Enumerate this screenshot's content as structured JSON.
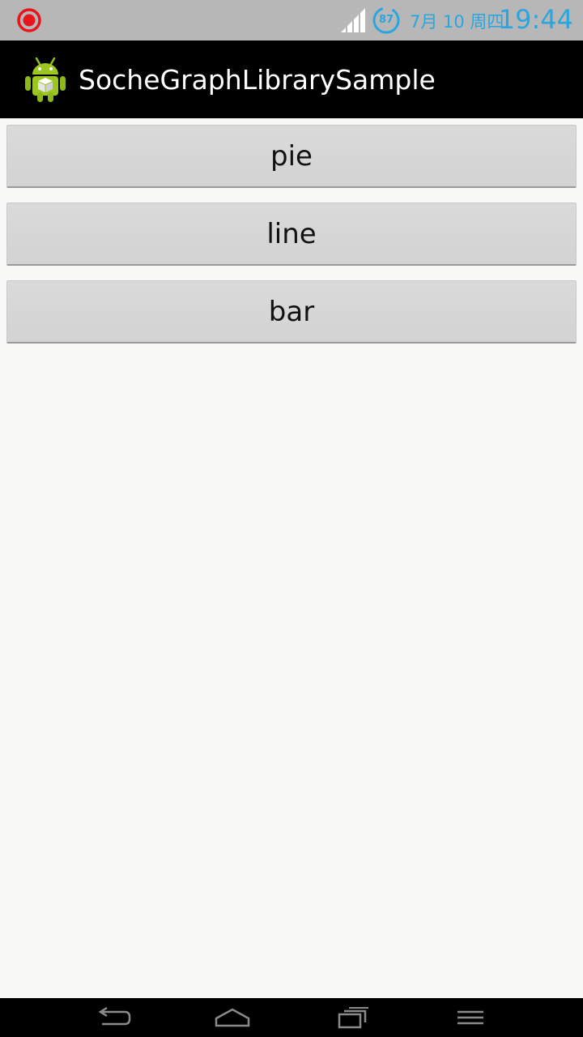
{
  "status_bar": {
    "battery_level": "87",
    "date": "7月 10 周四",
    "time": "19:44",
    "accent_color": "#2aa6df",
    "icons": [
      "screen-record-icon",
      "signal-icon",
      "battery-icon"
    ]
  },
  "action_bar": {
    "title": "SocheGraphLibrarySample",
    "icon": "android-app-icon"
  },
  "buttons": [
    {
      "label": "pie"
    },
    {
      "label": "line"
    },
    {
      "label": "bar"
    }
  ],
  "nav_bar": {
    "icons": [
      "back-icon",
      "home-icon",
      "recent-apps-icon",
      "menu-icon"
    ]
  }
}
